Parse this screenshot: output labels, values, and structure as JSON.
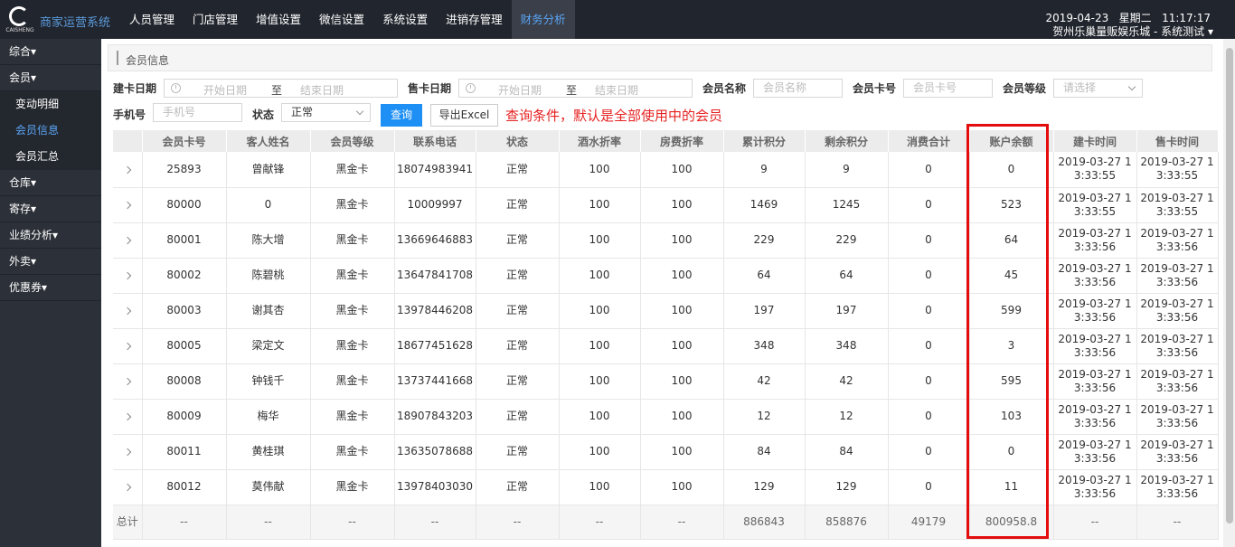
{
  "app": {
    "brand": "商家运营系统",
    "logo_text": "CAISHENG",
    "nav": [
      "人员管理",
      "门店管理",
      "增值设置",
      "微信设置",
      "系统设置",
      "进销存管理",
      "财务分析"
    ],
    "active_nav_index": 6,
    "datetime": "2019-04-23   星期二   11:17:17",
    "store": "贺州乐巢量贩娱乐城 - 系统测试 ▾"
  },
  "sidebar": {
    "items": [
      {
        "label": "综合▾",
        "type": "group"
      },
      {
        "label": "会员▾",
        "type": "group"
      },
      {
        "label": "变动明细",
        "type": "sub"
      },
      {
        "label": "会员信息",
        "type": "sub",
        "active": true
      },
      {
        "label": "会员汇总",
        "type": "sub"
      },
      {
        "label": "仓库▾",
        "type": "group"
      },
      {
        "label": "寄存▾",
        "type": "group"
      },
      {
        "label": "业绩分析▾",
        "type": "group"
      },
      {
        "label": "外卖▾",
        "type": "group"
      },
      {
        "label": "优惠券▾",
        "type": "group"
      }
    ]
  },
  "breadcrumb": "会员信息",
  "filters": {
    "build_date_label": "建卡日期",
    "build_date_start_ph": "开始日期",
    "build_date_sep": "至",
    "build_date_end_ph": "结束日期",
    "sale_date_label": "售卡日期",
    "sale_date_start_ph": "开始日期",
    "sale_date_sep": "至",
    "sale_date_end_ph": "结束日期",
    "member_name_label": "会员名称",
    "member_name_ph": "会员名称",
    "card_no_label": "会员卡号",
    "card_no_ph": "会员卡号",
    "level_label": "会员等级",
    "level_ph": "请选择",
    "phone_label": "手机号",
    "phone_ph": "手机号",
    "status_label": "状态",
    "status_value": "正常",
    "query_button": "查询",
    "export_button": "导出Excel",
    "note": "查询条件，默认是全部使用中的会员"
  },
  "table": {
    "columns": [
      "",
      "会员卡号",
      "客人姓名",
      "会员等级",
      "联系电话",
      "状态",
      "酒水折率",
      "房费折率",
      "累计积分",
      "剩余积分",
      "消费合计",
      "账户余额",
      "建卡时间",
      "售卡时间"
    ],
    "rows": [
      [
        "25893",
        "曾献锋",
        "黑金卡",
        "18074983941",
        "正常",
        "100",
        "100",
        "9",
        "9",
        "0",
        "0",
        "2019-03-27 13:33:55",
        "2019-03-27 13:33:55"
      ],
      [
        "80000",
        "0",
        "黑金卡",
        "10009997",
        "正常",
        "100",
        "100",
        "1469",
        "1245",
        "0",
        "523",
        "2019-03-27 13:33:55",
        "2019-03-27 13:33:55"
      ],
      [
        "80001",
        "陈大增",
        "黑金卡",
        "13669646883",
        "正常",
        "100",
        "100",
        "229",
        "229",
        "0",
        "64",
        "2019-03-27 13:33:56",
        "2019-03-27 13:33:56"
      ],
      [
        "80002",
        "陈碧桃",
        "黑金卡",
        "13647841708",
        "正常",
        "100",
        "100",
        "64",
        "64",
        "0",
        "45",
        "2019-03-27 13:33:56",
        "2019-03-27 13:33:56"
      ],
      [
        "80003",
        "谢其杏",
        "黑金卡",
        "13978446208",
        "正常",
        "100",
        "100",
        "197",
        "197",
        "0",
        "599",
        "2019-03-27 13:33:56",
        "2019-03-27 13:33:56"
      ],
      [
        "80005",
        "梁定文",
        "黑金卡",
        "18677451628",
        "正常",
        "100",
        "100",
        "348",
        "348",
        "0",
        "3",
        "2019-03-27 13:33:56",
        "2019-03-27 13:33:56"
      ],
      [
        "80008",
        "钟钱千",
        "黑金卡",
        "13737441668",
        "正常",
        "100",
        "100",
        "42",
        "42",
        "0",
        "595",
        "2019-03-27 13:33:56",
        "2019-03-27 13:33:56"
      ],
      [
        "80009",
        "梅华",
        "黑金卡",
        "18907843203",
        "正常",
        "100",
        "100",
        "12",
        "12",
        "0",
        "103",
        "2019-03-27 13:33:56",
        "2019-03-27 13:33:56"
      ],
      [
        "80011",
        "黄桂琪",
        "黑金卡",
        "13635078688",
        "正常",
        "100",
        "100",
        "84",
        "84",
        "0",
        "0",
        "2019-03-27 13:33:56",
        "2019-03-27 13:33:56"
      ],
      [
        "80012",
        "莫伟献",
        "黑金卡",
        "13978403030",
        "正常",
        "100",
        "100",
        "129",
        "129",
        "0",
        "11",
        "2019-03-27 13:33:56",
        "2019-03-27 13:33:56"
      ]
    ],
    "total_label": "总计",
    "total_row": [
      "--",
      "--",
      "--",
      "--",
      "--",
      "--",
      "--",
      "886843",
      "858876",
      "49179",
      "800958.8",
      "--",
      "--"
    ]
  },
  "colors": {
    "topbar": "#21252d",
    "accent": "#1e8ff4",
    "highlight": "#e40d0d"
  }
}
